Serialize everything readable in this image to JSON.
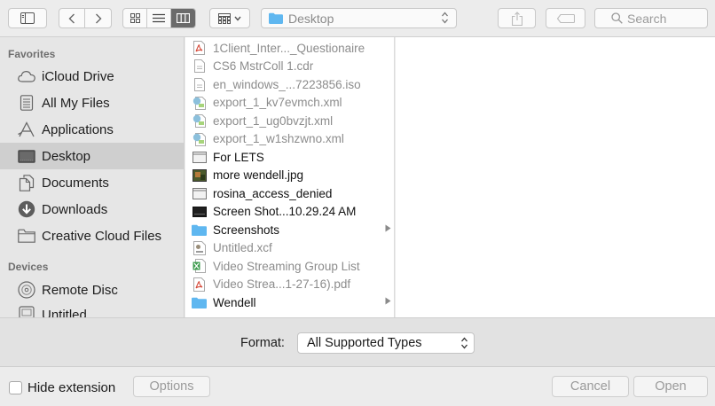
{
  "toolbar": {
    "location": "Desktop",
    "search_placeholder": "Search"
  },
  "sidebar": {
    "favorites_header": "Favorites",
    "favorites": [
      {
        "label": "iCloud Drive",
        "icon": "cloud-icon"
      },
      {
        "label": "All My Files",
        "icon": "all-files-icon"
      },
      {
        "label": "Applications",
        "icon": "applications-icon"
      },
      {
        "label": "Desktop",
        "icon": "desktop-icon",
        "selected": true
      },
      {
        "label": "Documents",
        "icon": "documents-icon"
      },
      {
        "label": "Downloads",
        "icon": "downloads-icon"
      },
      {
        "label": "Creative Cloud Files",
        "icon": "folder-icon"
      }
    ],
    "devices_header": "Devices",
    "devices": [
      {
        "label": "Remote Disc",
        "icon": "disc-icon"
      },
      {
        "label": "Untitled",
        "icon": "drive-icon"
      }
    ]
  },
  "files": [
    {
      "name": "1Client_Inter..._Questionaire",
      "icon": "pdf-icon",
      "enabled": false
    },
    {
      "name": "CS6 MstrColl 1.cdr",
      "icon": "document-icon",
      "enabled": false
    },
    {
      "name": "en_windows_...7223856.iso",
      "icon": "document-icon",
      "enabled": false
    },
    {
      "name": "export_1_kv7evmch.xml",
      "icon": "xml-icon",
      "enabled": false
    },
    {
      "name": "export_1_ug0bvzjt.xml",
      "icon": "xml-icon",
      "enabled": false
    },
    {
      "name": "export_1_w1shzwno.xml",
      "icon": "xml-icon",
      "enabled": false
    },
    {
      "name": "For LETS",
      "icon": "window-icon",
      "enabled": true
    },
    {
      "name": "more wendell.jpg",
      "icon": "image-icon",
      "enabled": true
    },
    {
      "name": "rosina_access_denied",
      "icon": "window-icon",
      "enabled": true
    },
    {
      "name": "Screen Shot...10.29.24 AM",
      "icon": "screenshot-icon",
      "enabled": true
    },
    {
      "name": "Screenshots",
      "icon": "folder-icon",
      "enabled": true,
      "folder": true
    },
    {
      "name": "Untitled.xcf",
      "icon": "xcf-icon",
      "enabled": false
    },
    {
      "name": "Video Streaming Group List",
      "icon": "spreadsheet-icon",
      "enabled": false
    },
    {
      "name": "Video Strea...1-27-16).pdf",
      "icon": "pdf-icon",
      "enabled": false
    },
    {
      "name": "Wendell",
      "icon": "folder-icon",
      "enabled": true,
      "folder": true
    }
  ],
  "format": {
    "label": "Format:",
    "selected": "All Supported Types"
  },
  "bottom": {
    "hide_extension_label": "Hide extension",
    "hide_extension_checked": false,
    "options_label": "Options",
    "cancel_label": "Cancel",
    "open_label": "Open"
  },
  "colors": {
    "folder_blue": "#5fb7f0",
    "selection_gray": "#cfcfcf",
    "pdf_red": "#d64a3a"
  }
}
